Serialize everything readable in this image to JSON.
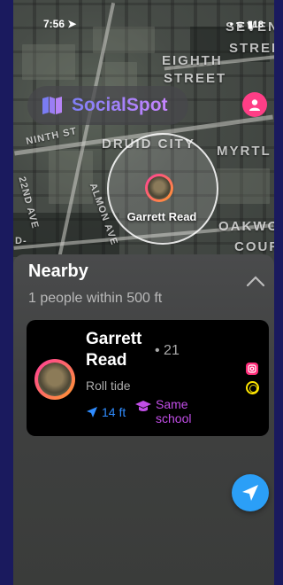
{
  "status_bar": {
    "time": "7:56",
    "icons": "• ᯤ ▮18"
  },
  "app": {
    "name": "SocialSpot"
  },
  "map": {
    "streets": [
      "SEVENTH",
      "STREET",
      "EIGHTH",
      "STREET",
      "NINTH ST",
      "DRUID CITY",
      "MYRTL",
      "22ND AVE",
      "ALMON AVE",
      "OAKWO",
      "COUR",
      "D-"
    ],
    "pin_label": "Garrett Read"
  },
  "sheet": {
    "title": "Nearby",
    "subtitle": "1 people within 500 ft"
  },
  "nearby": [
    {
      "name": "Garrett Read",
      "age": "• 21",
      "bio": "Roll tide",
      "distance": "14 ft",
      "school_badge": "Same school"
    }
  ],
  "colors": {
    "accent": "#8b80ff",
    "profile": "#ff3e86",
    "distance": "#2f8cff",
    "school": "#c24ee8",
    "instagram": "#ff2e7a",
    "snapchat": "#ffe600",
    "locate_button": "#2b9ff7"
  }
}
